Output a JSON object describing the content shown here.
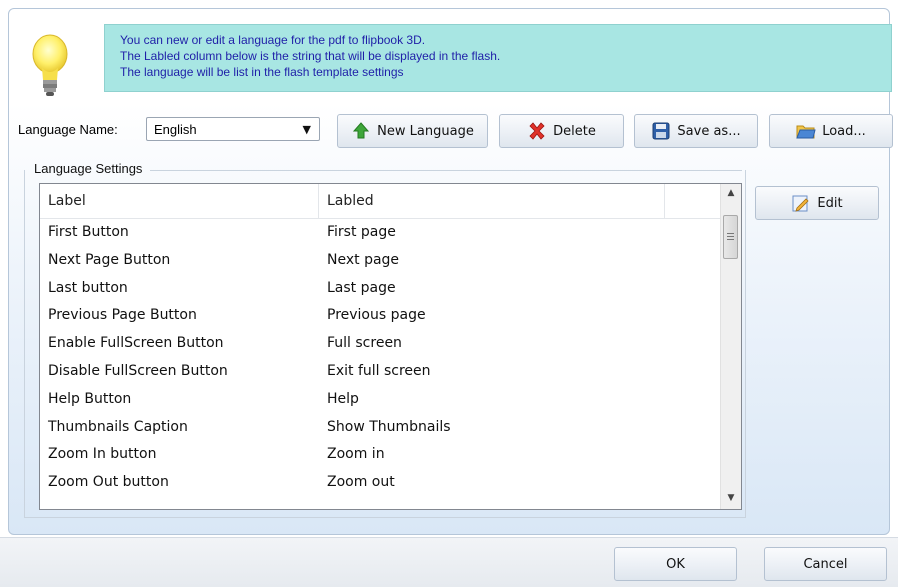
{
  "info": {
    "lines": [
      "You can new or edit  a language for the pdf to flipbook 3D.",
      "The Labled column below is the string that will be displayed in the flash.",
      "The language will be list in the flash template settings"
    ],
    "icon": "lightbulb-icon"
  },
  "language": {
    "label": "Language Name:",
    "selected": "English"
  },
  "toolbar": {
    "new_language": "New Language",
    "delete": "Delete",
    "save_as": "Save as...",
    "load": "Load...",
    "edit": "Edit"
  },
  "settings": {
    "group_label": "Language Settings",
    "columns": [
      "Label",
      "Labled"
    ],
    "rows": [
      {
        "label": "First Button",
        "labled": "First page"
      },
      {
        "label": "Next Page Button",
        "labled": "Next page"
      },
      {
        "label": "Last button",
        "labled": "Last page"
      },
      {
        "label": "Previous Page Button",
        "labled": "Previous page"
      },
      {
        "label": "Enable FullScreen Button",
        "labled": "Full screen"
      },
      {
        "label": "Disable FullScreen Button",
        "labled": "Exit full screen"
      },
      {
        "label": "Help Button",
        "labled": "Help"
      },
      {
        "label": "Thumbnails Caption",
        "labled": "Show Thumbnails"
      },
      {
        "label": "Zoom In button",
        "labled": "Zoom in"
      },
      {
        "label": "Zoom Out button",
        "labled": "Zoom out"
      }
    ]
  },
  "footer": {
    "ok": "OK",
    "cancel": "Cancel"
  }
}
